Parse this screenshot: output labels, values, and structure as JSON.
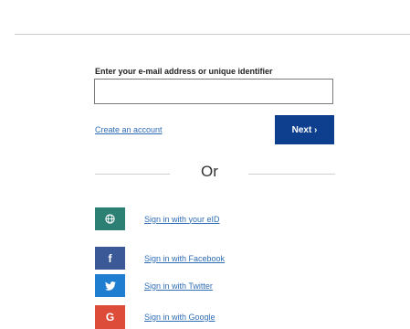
{
  "form": {
    "label": "Enter your e-mail address or unique identifier",
    "input_value": "",
    "input_placeholder": "",
    "create_account_label": "Create an account",
    "next_label": "Next ›"
  },
  "divider": {
    "text": "Or"
  },
  "signin_options": [
    {
      "label": "Sign in with your eID",
      "icon": "globe-icon",
      "color": "#2b7f73",
      "glyph": ""
    },
    {
      "label": "Sign in with Facebook",
      "icon": "facebook-icon",
      "color": "#3b5997",
      "glyph": "f"
    },
    {
      "label": "Sign in with Twitter",
      "icon": "twitter-icon",
      "color": "#1f7ed0",
      "glyph": ""
    },
    {
      "label": "Sign in with Google",
      "icon": "google-icon",
      "color": "#dd4b39",
      "glyph": "G"
    }
  ],
  "colors": {
    "next_button": "#0e3f8f",
    "link": "#2f6db5"
  }
}
